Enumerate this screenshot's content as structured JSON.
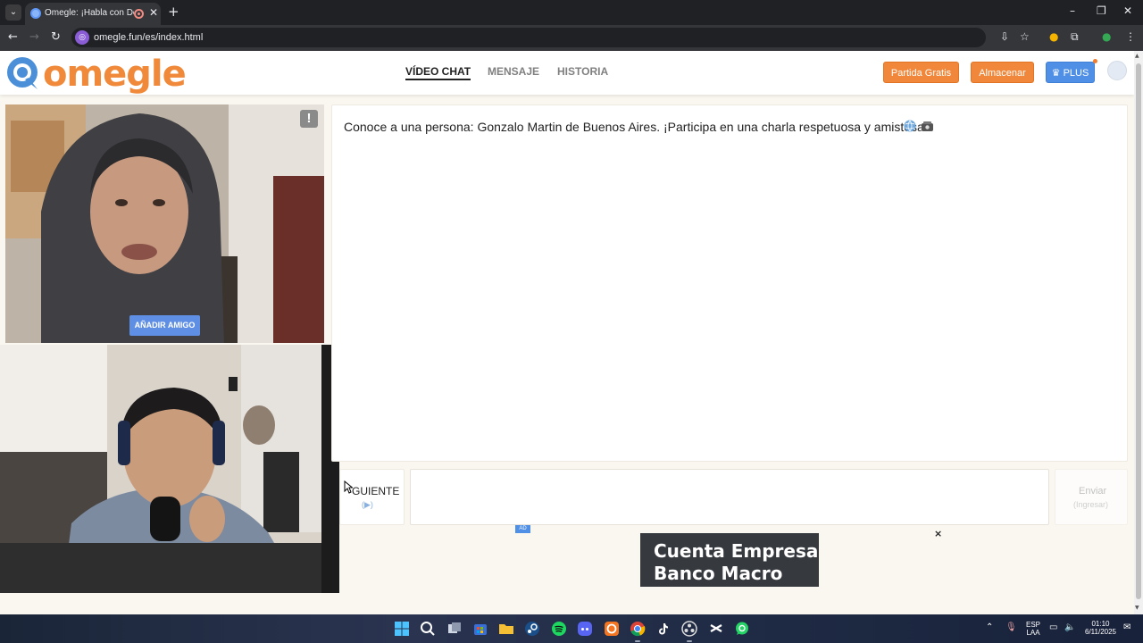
{
  "browser": {
    "tab_title": "Omegle: ¡Habla con Descon",
    "url": "omegle.fun/es/index.html"
  },
  "header": {
    "logo_text": "omegle",
    "nav": [
      {
        "label": "VÍDEO CHAT",
        "active": true
      },
      {
        "label": "MENSAJE",
        "active": false
      },
      {
        "label": "HISTORIA",
        "active": false
      }
    ],
    "buttons": {
      "free_game": "Partida Gratis",
      "store": "Almacenar",
      "plus": "♛ PLUS"
    }
  },
  "video": {
    "report_label": "!",
    "add_friend_label": "AÑADIR AMIGO"
  },
  "chat": {
    "message": "Conoce a una persona: Gonzalo Martin de Buenos Aires. ¡Participa en una charla respetuosa y amistosa!",
    "next_label": "GUIENTE",
    "next_hint": "(▶)",
    "input_value": "",
    "send_label": "Enviar",
    "send_hint": "(Ingresar)"
  },
  "ad": {
    "badge": "AD",
    "line1": "Cuenta Empresa",
    "line2": "Banco Macro",
    "close": "×"
  },
  "taskbar": {
    "apps": [
      "start-icon",
      "search-icon",
      "task-view-icon",
      "store-icon",
      "file-explorer-icon",
      "steam-icon",
      "spotify-icon",
      "discord-icon",
      "crunchyroll-icon",
      "chrome-icon",
      "tiktok-icon",
      "obs-icon",
      "capcut-icon",
      "whatsapp-icon"
    ],
    "lang_top": "ESP",
    "lang_bottom": "LAA",
    "time": "01:10",
    "date": "6/11/2025"
  },
  "colors": {
    "accent_orange": "#f0873a",
    "accent_blue": "#4f8fe6",
    "page_bg": "#faf7f1"
  }
}
